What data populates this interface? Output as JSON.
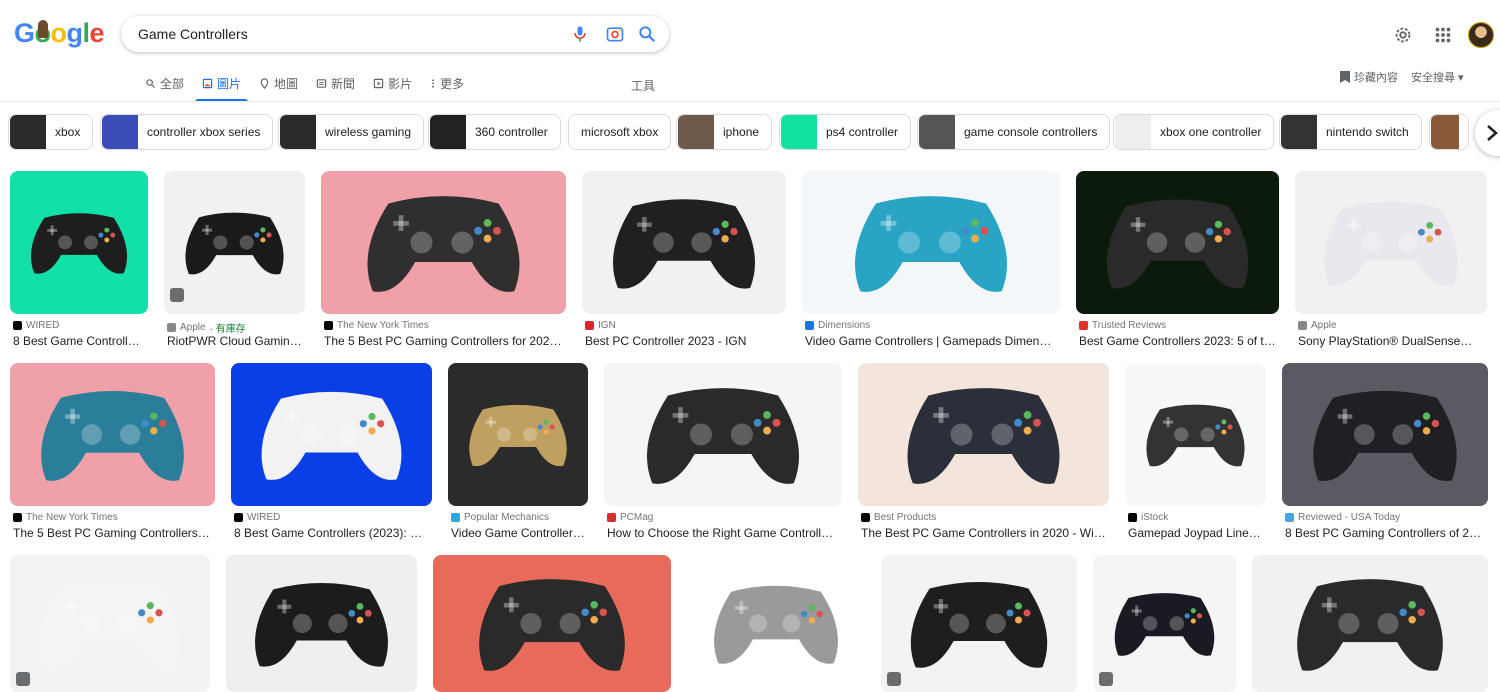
{
  "search": {
    "query": "Game Controllers"
  },
  "logo_text": "Google",
  "tabs": [
    {
      "label": "全部",
      "icon": "search-icon"
    },
    {
      "label": "圖片",
      "icon": "image-icon"
    },
    {
      "label": "地圖",
      "icon": "map-pin-icon"
    },
    {
      "label": "新聞",
      "icon": "news-icon"
    },
    {
      "label": "影片",
      "icon": "video-icon"
    },
    {
      "label": "更多",
      "icon": "more-dots-icon"
    }
  ],
  "tools_label": "工具",
  "saved_label": "珍藏內容",
  "safesearch_label": "安全搜尋 ▾",
  "chips": [
    {
      "label": "xbox",
      "color": "#2b2b2b"
    },
    {
      "label": "controller xbox series",
      "color": "#3b4bb8"
    },
    {
      "label": "wireless gaming",
      "color": "#2a2a2a"
    },
    {
      "label": "360 controller",
      "color": "#222222"
    },
    {
      "label": "microsoft xbox",
      "color": ""
    },
    {
      "label": "iphone",
      "color": "#6d5a4a"
    },
    {
      "label": "ps4 controller",
      "color": "#12e0a0"
    },
    {
      "label": "game console controllers",
      "color": "#555555"
    },
    {
      "label": "xbox one controller",
      "color": "#eeeeee"
    },
    {
      "label": "nintendo switch",
      "color": "#333333"
    }
  ],
  "results": [
    {
      "source": "WIRED",
      "title": "8 Best Game Controller...",
      "fav": "#000000",
      "bg": "#12e0a8",
      "obj": "#1e1e1e",
      "note": ""
    },
    {
      "source": "Apple",
      "note": "· 有庫存",
      "title": "RiotPWR Cloud Gaming ...",
      "fav": "#888888",
      "bg": "#f1f1f1",
      "obj": "#1a1a1a"
    },
    {
      "source": "The New York Times",
      "title": "The 5 Best PC Gaming Controllers for 2023 | ...",
      "fav": "#000000",
      "bg": "#f0a0a8",
      "obj": "#2f2f2f",
      "note": ""
    },
    {
      "source": "IGN",
      "title": "Best PC Controller 2023 - IGN",
      "fav": "#d9282b",
      "bg": "#f1f1f1",
      "obj": "#202020",
      "note": ""
    },
    {
      "source": "Dimensions",
      "title": "Video Game Controllers | Gamepads Dimension...",
      "fav": "#1a73e8",
      "bg": "#f4f7f9",
      "obj": "#2aa4c4",
      "note": ""
    },
    {
      "source": "Trusted Reviews",
      "title": "Best Game Controllers 2023: 5 of the...",
      "fav": "#e4322b",
      "bg": "#0c1a0c",
      "obj": "#2a2a2a",
      "note": ""
    },
    {
      "source": "Apple",
      "title": "Sony PlayStation® DualSense™ W...",
      "fav": "#888888",
      "bg": "#f1f1f1",
      "obj": "#e8e8ee",
      "note": ""
    },
    {
      "source": "The New York Times",
      "title": "The 5 Best PC Gaming Controllers fo...",
      "fav": "#000000",
      "bg": "#f0a0a8",
      "obj": "#2a7e9a",
      "note": ""
    },
    {
      "source": "WIRED",
      "title": "8 Best Game Controllers (2023): PC,...",
      "fav": "#000000",
      "bg": "#0a3ee6",
      "obj": "#f2f2f2",
      "note": ""
    },
    {
      "source": "Popular Mechanics",
      "title": "Video Game Controllers ...",
      "fav": "#2aa6e0",
      "bg": "#2b2b2b",
      "obj": "#c0a060",
      "note": ""
    },
    {
      "source": "PCMag",
      "title": "How to Choose the Right Game Controller f...",
      "fav": "#d32f2f",
      "bg": "#f5f5f5",
      "obj": "#2a2a2a",
      "note": ""
    },
    {
      "source": "Best Products",
      "title": "The Best PC Game Controllers in 2020 - Wirel...",
      "fav": "#000000",
      "bg": "#f3e5dc",
      "obj": "#2a2f3a",
      "note": ""
    },
    {
      "source": "iStock",
      "title": "Gamepad Joypad Linear ...",
      "fav": "#000000",
      "bg": "#f8f8f8",
      "obj": "#333333",
      "note": ""
    },
    {
      "source": "Reviewed - USA Today",
      "title": "8 Best PC Gaming Controllers of 202...",
      "fav": "#4aa3e0",
      "bg": "#5a5a62",
      "obj": "#1f1f24",
      "note": ""
    },
    {
      "source": "",
      "title": "",
      "fav": "",
      "bg": "#f3f3f3",
      "obj": "#f4f4f4",
      "note": ""
    },
    {
      "source": "",
      "title": "",
      "fav": "",
      "bg": "#efefef",
      "obj": "#1c1c1c",
      "note": ""
    },
    {
      "source": "",
      "title": "",
      "fav": "",
      "bg": "#e86a5a",
      "obj": "#2a2a2a",
      "note": ""
    },
    {
      "source": "",
      "title": "",
      "fav": "",
      "bg": "#ffffff",
      "obj": "#9a9a9a",
      "note": ""
    },
    {
      "source": "",
      "title": "",
      "fav": "",
      "bg": "#f3f3f3",
      "obj": "#1e1e1e",
      "note": ""
    },
    {
      "source": "",
      "title": "",
      "fav": "",
      "bg": "#f5f5f5",
      "obj": "#1a1a22",
      "note": ""
    },
    {
      "source": "",
      "title": "",
      "fav": "",
      "bg": "#f1f1f1",
      "obj": "#2a2a2a",
      "note": ""
    }
  ]
}
